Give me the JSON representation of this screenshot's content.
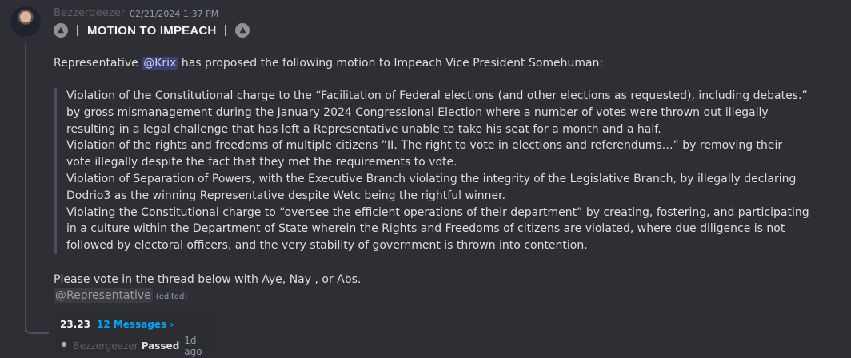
{
  "message": {
    "author": "Bezzergeezer",
    "timestamp": "02/21/2024 1:37 PM",
    "title": "MOTION TO IMPEACH",
    "title_icon": "up-arrow-circle-icon",
    "intro_before": "Representative ",
    "mention": "@Krix",
    "intro_after": " has proposed the following motion to Impeach Vice President Somehuman:",
    "quote_paragraphs": [
      "Violation of the Constitutional charge to the “Facilitation of Federal elections (and other elections as requested), including debates.” by gross mismanagement during the January 2024 Congressional Election where a number of votes were thrown out illegally resulting in a legal challenge that has left a Representative unable to take his seat for a month and a half.",
      "Violation of the rights and freedoms of multiple citizens ”II. The right to vote in elections and referendums…” by removing their vote illegally despite the fact that they met the requirements to vote.",
      "Violation of Separation of Powers, with the Executive Branch violating the integrity of the Legislative Branch, by illegally declaring Dodrio3 as the winning Representative despite Wetc being the rightful winner.",
      "Violating the Constitutional charge to “oversee the efficient operations of their department” by creating, fostering, and participating in a culture within the Department of State wherein the Rights and Freedoms of citizens are violated, where due diligence is not followed by electoral officers, and the very stability of government is thrown into contention."
    ],
    "vote_text": "Please vote in the thread below with Aye, Nay , or Abs.",
    "role_mention": "@Representative",
    "edited_label": "(edited)"
  },
  "thread": {
    "name": "23.23",
    "count_label": "12 Messages ›",
    "last_author": "Bezzergeezer",
    "last_message": "Passed",
    "last_time": "1d ago"
  }
}
